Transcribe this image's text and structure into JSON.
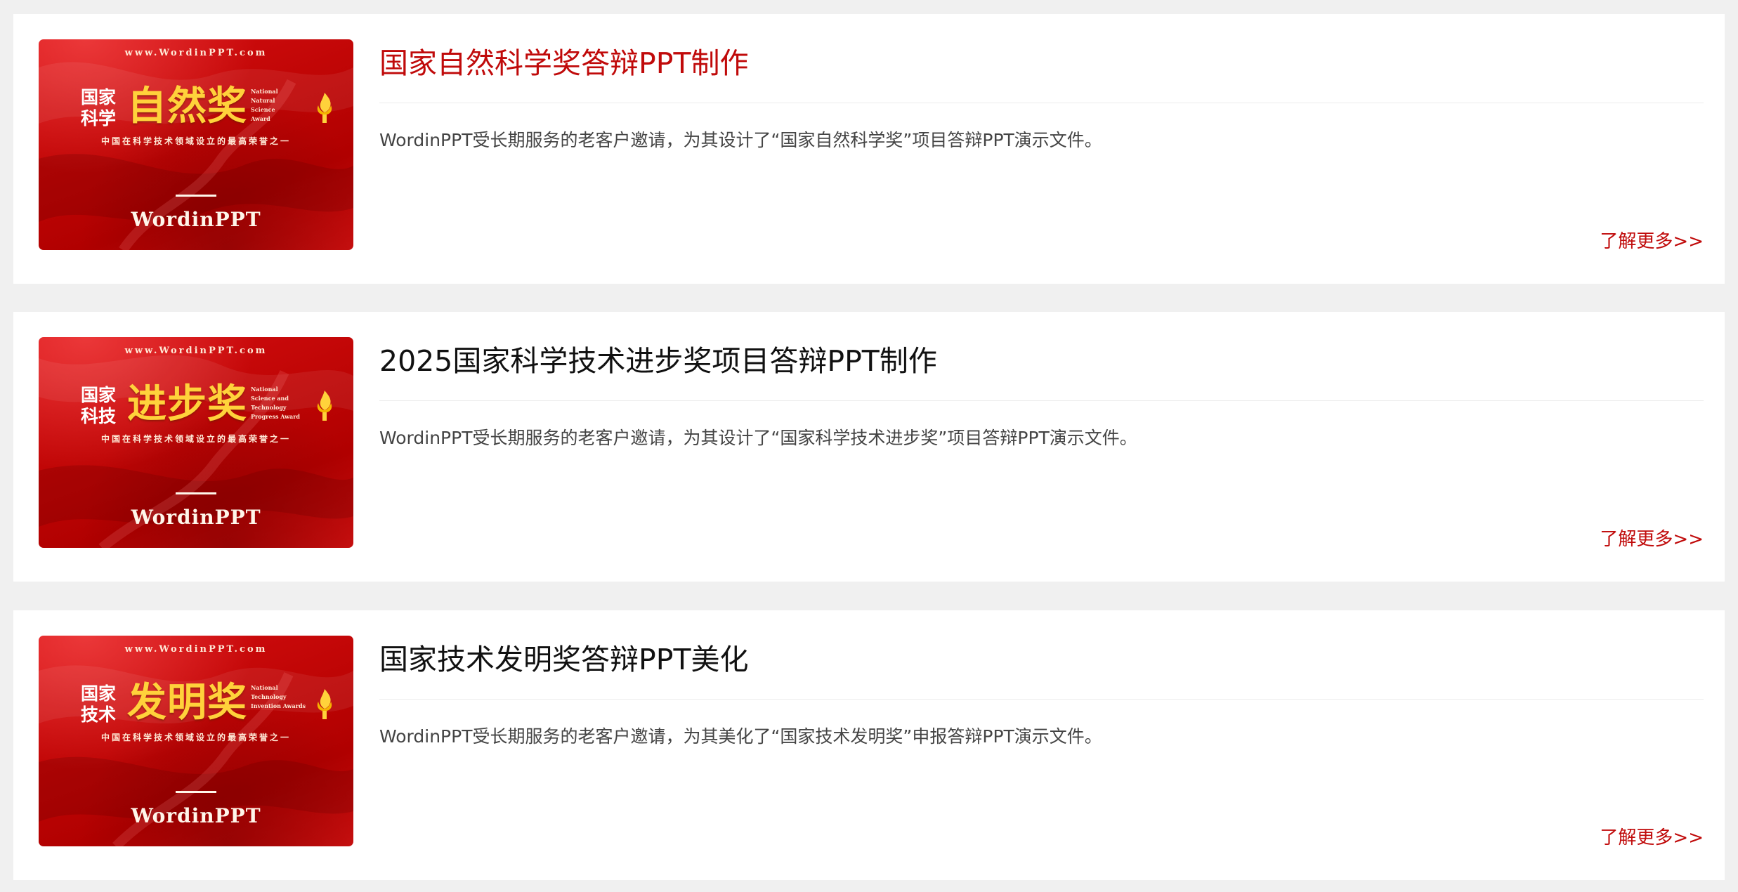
{
  "colors": {
    "accent_red": "#c00a0a",
    "page_background": "#f0f0f0",
    "card_background": "#ffffff",
    "thumbnail_red": "#c10606",
    "thumbnail_gold": "#ffd23b"
  },
  "posts": [
    {
      "title": "国家自然科学奖答辩PPT制作",
      "summary": "WordinPPT受长期服务的老客户邀请，为其设计了“国家自然科学奖”项目答辩PPT演示文件。",
      "more_label": "了解更多>>",
      "title_active": true,
      "thumbnail": {
        "site": "www.WordinPPT.com",
        "small_title": "国家 科学",
        "big_title": "自然奖",
        "english_lines": [
          "National",
          "Natural",
          "Science",
          "Award"
        ],
        "tagline": "中国在科学技术领域设立的最高荣誉之一",
        "brand": "WordinPPT",
        "icon": "torch-flame-icon"
      }
    },
    {
      "title": "2025国家科学技术进步奖项目答辩PPT制作",
      "summary": "WordinPPT受长期服务的老客户邀请，为其设计了“国家科学技术进步奖”项目答辩PPT演示文件。",
      "more_label": "了解更多>>",
      "title_active": false,
      "thumbnail": {
        "site": "www.WordinPPT.com",
        "small_title": "国家 科技",
        "big_title": "进步奖",
        "english_lines": [
          "National",
          "Science and",
          "Technology",
          "Progress Award"
        ],
        "tagline": "中国在科学技术领域设立的最高荣誉之一",
        "brand": "WordinPPT",
        "icon": "torch-flame-icon"
      }
    },
    {
      "title": "国家技术发明奖答辩PPT美化",
      "summary": "WordinPPT受长期服务的老客户邀请，为其美化了“国家技术发明奖”申报答辩PPT演示文件。",
      "more_label": "了解更多>>",
      "title_active": false,
      "thumbnail": {
        "site": "www.WordinPPT.com",
        "small_title": "国家 技术",
        "big_title": "发明奖",
        "english_lines": [
          "National",
          "Technology",
          "Invention Awards"
        ],
        "tagline": "中国在科学技术领域设立的最高荣誉之一",
        "brand": "WordinPPT",
        "icon": "torch-flame-icon"
      }
    }
  ]
}
